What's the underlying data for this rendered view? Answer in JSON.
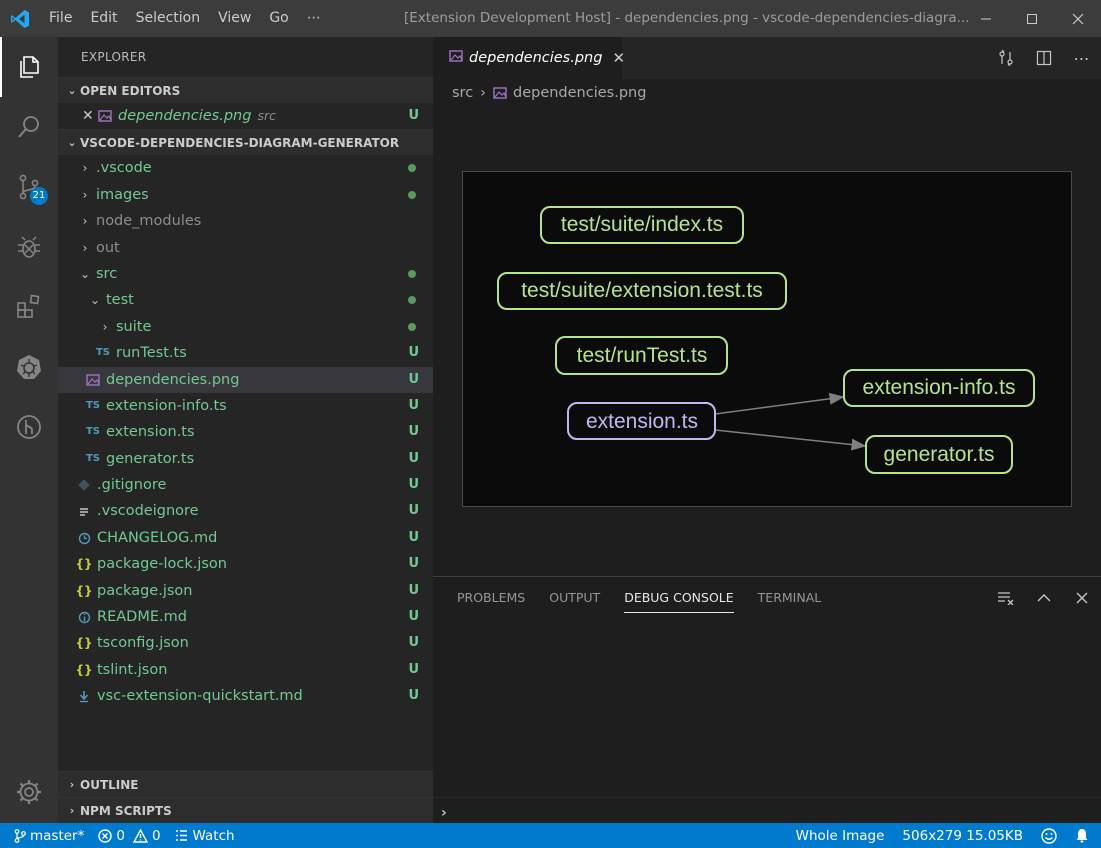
{
  "titlebar": {
    "menu": [
      "File",
      "Edit",
      "Selection",
      "View",
      "Go",
      "⋯"
    ],
    "window_title": "[Extension Development Host] - dependencies.png - vscode-dependencies-diagra..."
  },
  "activitybar": {
    "items": [
      "explorer-icon",
      "search-icon",
      "source-control-icon",
      "debug-icon",
      "extensions-icon",
      "kubernetes-icon",
      "gitlens-icon"
    ],
    "scm_badge": "21",
    "bottom": "settings-gear-icon"
  },
  "sidebar": {
    "title": "EXPLORER",
    "open_editors": {
      "header": "OPEN EDITORS",
      "file": "dependencies.png",
      "folder": "src",
      "status": "U"
    },
    "project": {
      "header": "VSCODE-DEPENDENCIES-DIAGRAM-GENERATOR",
      "rows": [
        {
          "label": ".vscode"
        },
        {
          "label": "images"
        },
        {
          "label": "node_modules"
        },
        {
          "label": "out"
        },
        {
          "label": "src"
        },
        {
          "label": "test"
        },
        {
          "label": "suite"
        },
        {
          "label": "runTest.ts",
          "icon": "TS",
          "status": "U"
        },
        {
          "label": "dependencies.png",
          "status": "U"
        },
        {
          "label": "extension-info.ts",
          "icon": "TS",
          "status": "U"
        },
        {
          "label": "extension.ts",
          "icon": "TS",
          "status": "U"
        },
        {
          "label": "generator.ts",
          "icon": "TS",
          "status": "U"
        },
        {
          "label": ".gitignore",
          "status": "U"
        },
        {
          "label": ".vscodeignore",
          "status": "U"
        },
        {
          "label": "CHANGELOG.md",
          "status": "U"
        },
        {
          "label": "package-lock.json",
          "icon": "{}",
          "status": "U"
        },
        {
          "label": "package.json",
          "icon": "{}",
          "status": "U"
        },
        {
          "label": "README.md",
          "status": "U"
        },
        {
          "label": "tsconfig.json",
          "icon": "{}",
          "status": "U"
        },
        {
          "label": "tslint.json",
          "icon": "{}",
          "status": "U"
        },
        {
          "label": "vsc-extension-quickstart.md",
          "status": "U"
        }
      ]
    },
    "outline_header": "OUTLINE",
    "npm_header": "NPM SCRIPTS"
  },
  "editor": {
    "tab_label": "dependencies.png",
    "breadcrumb": [
      "src",
      "dependencies.png"
    ],
    "diagram": {
      "nodes": [
        "test/suite/index.ts",
        "test/suite/extension.test.ts",
        "test/runTest.ts",
        "extension.ts",
        "extension-info.ts",
        "generator.ts"
      ],
      "node_color": "#b5e48c",
      "entry_node_color": "#c3b6f2"
    }
  },
  "panel": {
    "tabs": [
      "PROBLEMS",
      "OUTPUT",
      "DEBUG CONSOLE",
      "TERMINAL"
    ],
    "prompt": "›"
  },
  "statusbar": {
    "branch": "master*",
    "errors": "0",
    "warnings": "0",
    "watch": "Watch",
    "zoom": "Whole Image",
    "image_info": "506x279 15.05KB",
    "accent": "#007acc"
  }
}
